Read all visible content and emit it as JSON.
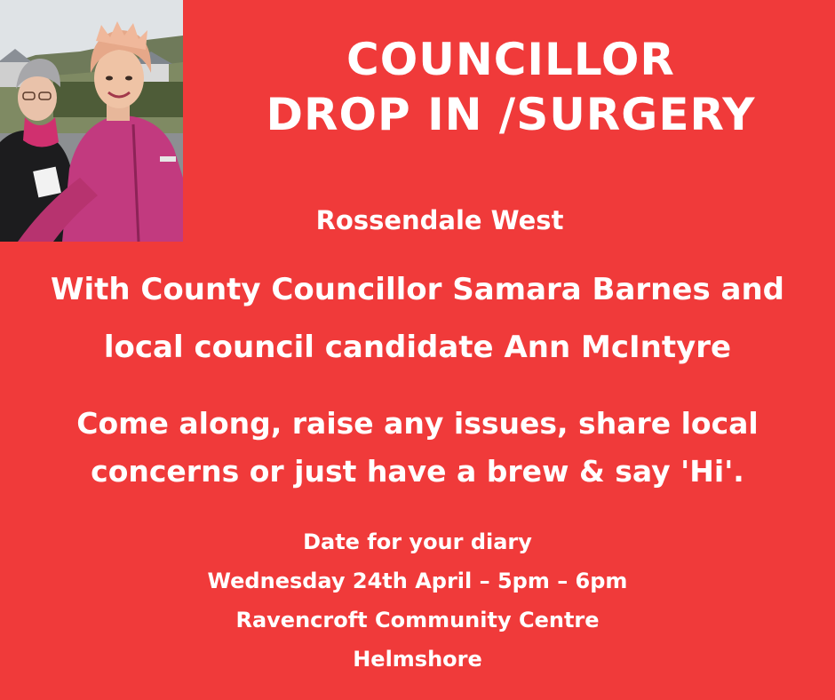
{
  "poster": {
    "title_line1": "COUNCILLOR",
    "title_line2": "DROP IN /SURGERY",
    "ward": "Rossendale West",
    "with_line1": "With County Councillor Samara Barnes and",
    "with_line2": "local council candidate Ann McIntyre",
    "invite_line1": "Come along, raise any issues, share local",
    "invite_line2": "concerns or just have a brew & say 'Hi'.",
    "date_heading": "Date for your diary",
    "date_time": "Wednesday 24th April – 5pm – 6pm",
    "venue": "Ravencroft Community Centre",
    "place": "Helmshore"
  },
  "colors": {
    "background": "#f03a3a",
    "text": "#ffffff"
  }
}
